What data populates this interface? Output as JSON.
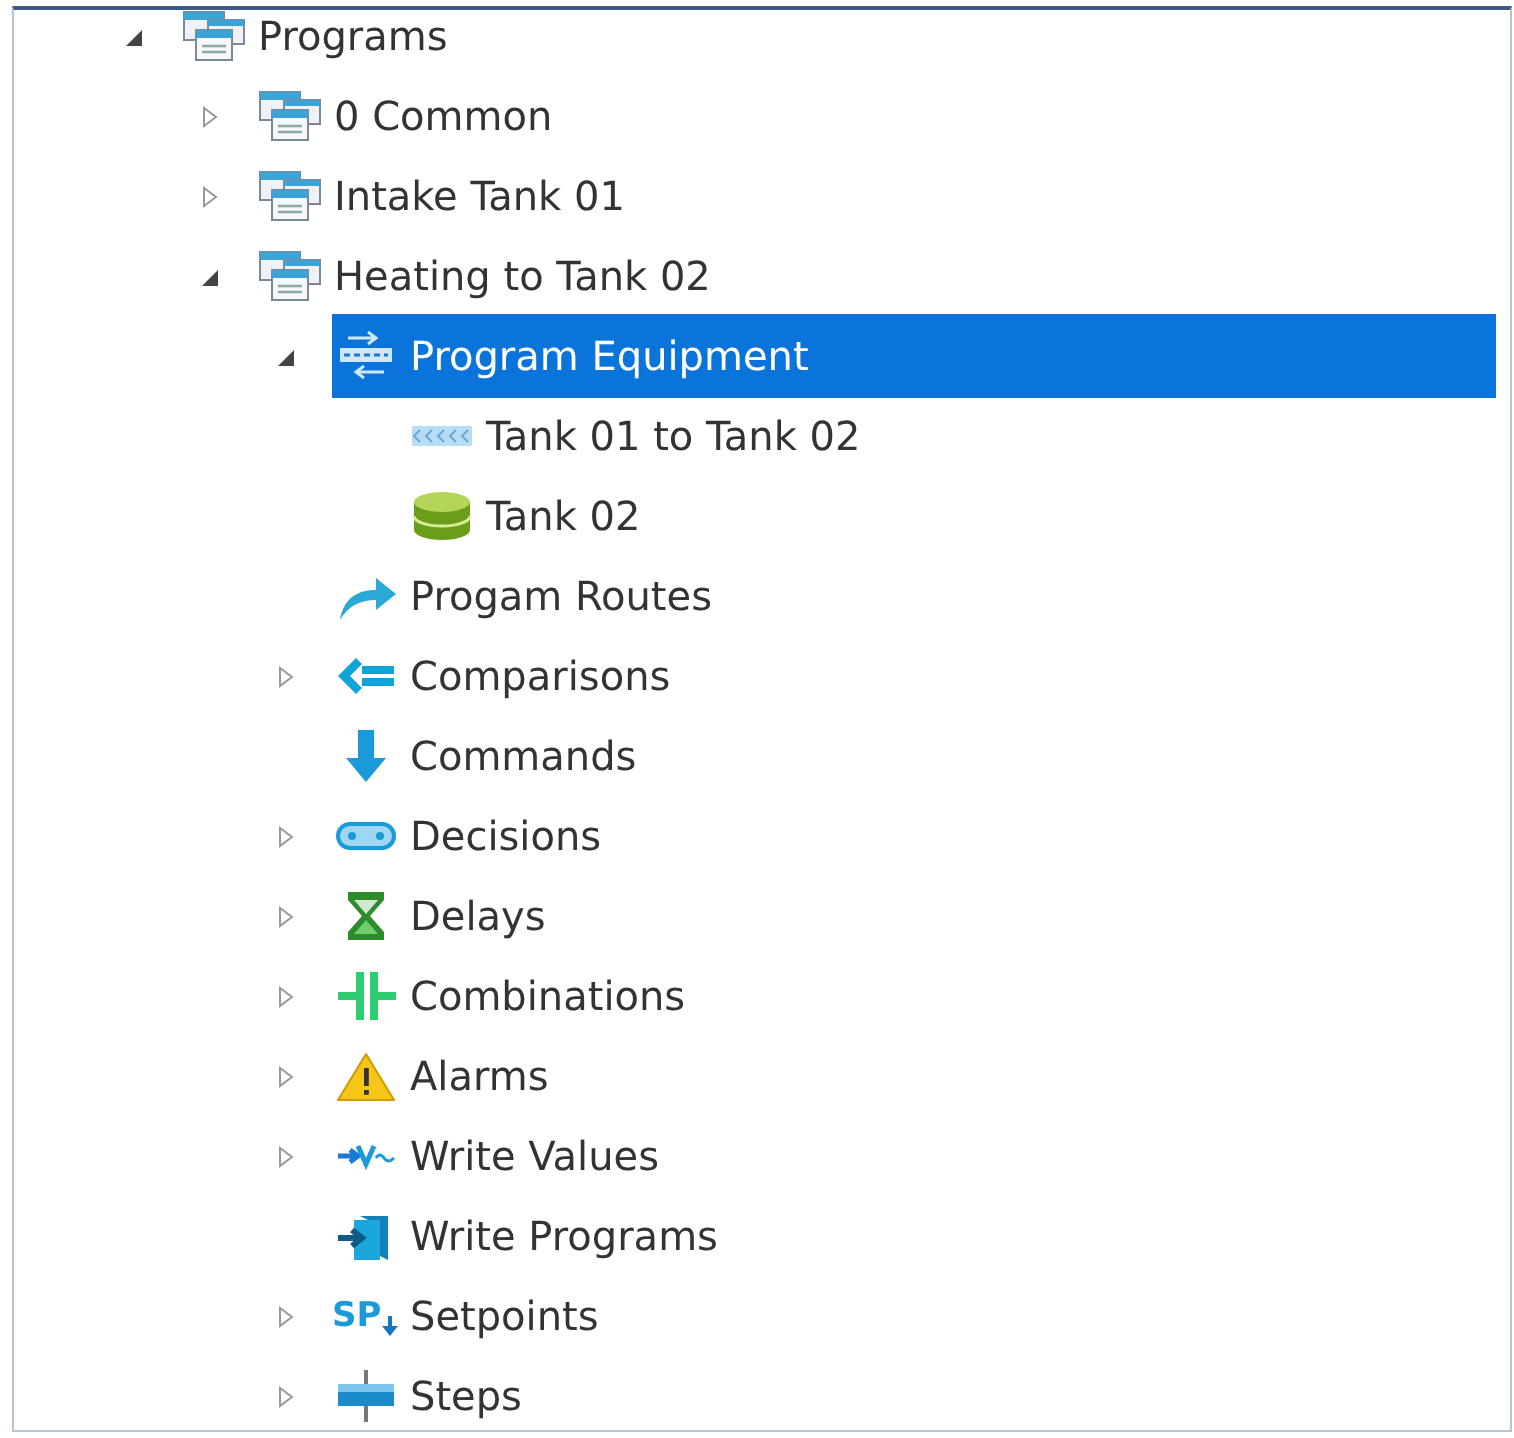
{
  "tree": [
    {
      "label": "Programs",
      "kind": "program",
      "expanded": true,
      "selected": false,
      "children": [
        {
          "label": "0 Common",
          "kind": "program",
          "expanded": false,
          "selected": false
        },
        {
          "label": "Intake Tank 01",
          "kind": "program",
          "expanded": false,
          "selected": false
        },
        {
          "label": "Heating to Tank 02",
          "kind": "program",
          "expanded": true,
          "selected": false,
          "children": [
            {
              "label": "Program Equipment",
              "kind": "equipment",
              "expanded": true,
              "selected": true,
              "children": [
                {
                  "label": "Tank 01 to Tank 02",
                  "kind": "pipe",
                  "selected": false
                },
                {
                  "label": "Tank 02",
                  "kind": "tank",
                  "selected": false
                }
              ]
            },
            {
              "label": "Progam Routes",
              "kind": "route",
              "selected": false
            },
            {
              "label": "Comparisons",
              "kind": "comparison",
              "expanded": false,
              "selected": false
            },
            {
              "label": "Commands",
              "kind": "command",
              "selected": false
            },
            {
              "label": "Decisions",
              "kind": "decision",
              "expanded": false,
              "selected": false
            },
            {
              "label": "Delays",
              "kind": "delay",
              "expanded": false,
              "selected": false
            },
            {
              "label": "Combinations",
              "kind": "combination",
              "expanded": false,
              "selected": false
            },
            {
              "label": "Alarms",
              "kind": "alarm",
              "expanded": false,
              "selected": false
            },
            {
              "label": "Write Values",
              "kind": "write",
              "expanded": false,
              "selected": false
            },
            {
              "label": "Write Programs",
              "kind": "import",
              "selected": false
            },
            {
              "label": "Setpoints",
              "kind": "setpoint",
              "icon_text": "SP",
              "expanded": false,
              "selected": false
            },
            {
              "label": "Steps",
              "kind": "step",
              "expanded": false,
              "selected": false
            }
          ]
        }
      ]
    }
  ]
}
